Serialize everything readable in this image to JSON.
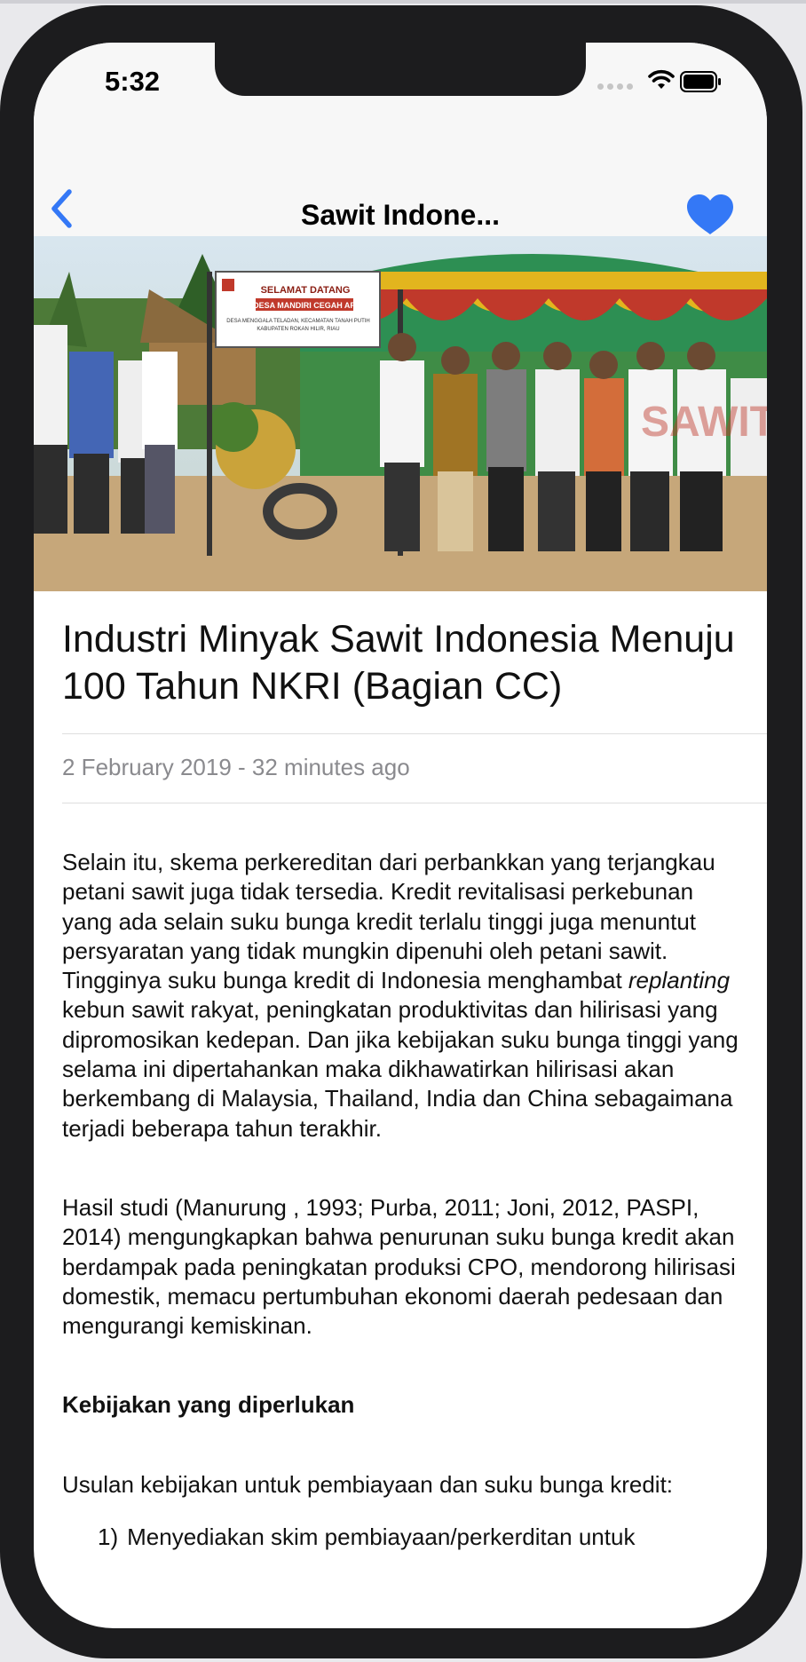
{
  "status_bar": {
    "time": "5:32"
  },
  "nav": {
    "title": "Sawit Indone...",
    "back_icon": "chevron-left-icon",
    "favorite_icon": "heart-icon",
    "accent": "#3478f6"
  },
  "hero": {
    "banner_line1": "SELAMAT DATANG",
    "banner_line2": "DESA MANDIRI CEGAH API",
    "banner_line3": "DESA MENGGALA TELADAN, KECAMATAN TANAH PUTIH",
    "banner_line4": "KABUPATEN ROKAN HILIR, RIAU",
    "watermark": "SAWIT"
  },
  "article": {
    "title": "Industri Minyak Sawit Indonesia Menuju 100 Tahun NKRI (Bagian CC)",
    "meta": "2 February 2019 - 32 minutes ago",
    "p1_before": "Selain itu, skema perkereditan dari perbankkan yang terjangkau petani sawit juga tidak tersedia. Kredit revitalisasi perkebunan yang ada selain suku bunga kredit terlalu tinggi juga menuntut persyaratan yang tidak mungkin dipenuhi oleh petani sawit. Tingginya suku bunga kredit di Indonesia menghambat ",
    "p1_italic": "replanting",
    "p1_after": " kebun sawit rakyat, peningkatan produktivitas dan hilirisasi yang dipromosikan kedepan. Dan jika kebijakan suku bunga tinggi yang selama ini dipertahankan maka dikhawatirkan hilirisasi akan berkembang di Malaysia, Thailand, India dan China sebagaimana terjadi beberapa tahun terakhir.",
    "p2": "Hasil studi (Manurung , 1993; Purba, 2011; Joni, 2012, PASPI, 2014) mengungkapkan bahwa penurunan suku bunga kredit akan berdampak pada peningkatan produksi CPO, mendorong hilirisasi domestik, memacu pertumbuhan ekonomi daerah pedesaan dan mengurangi kemiskinan.",
    "heading": "Kebijakan yang diperlukan",
    "p3": "Usulan kebijakan untuk pembiayaan dan suku bunga kredit:",
    "list": [
      {
        "num": "1)",
        "text": "Menyediakan skim pembiayaan/perkerditan untuk"
      }
    ]
  }
}
